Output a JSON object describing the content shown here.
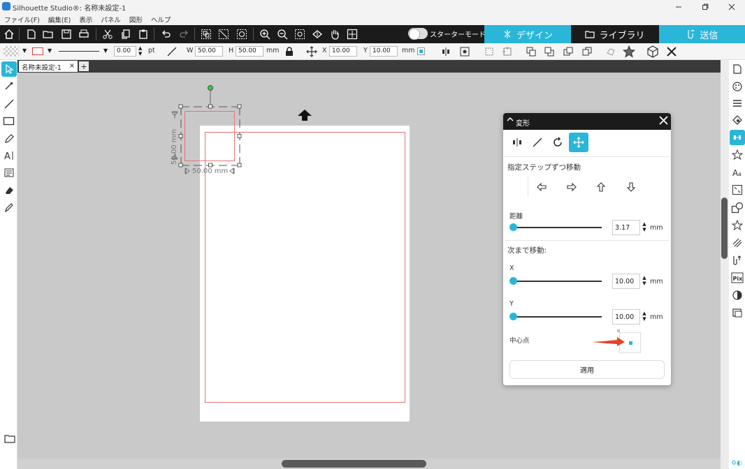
{
  "window": {
    "title": "Silhouette Studio®: 名称未設定-1"
  },
  "menu": [
    "ファイル(F)",
    "編集(E)",
    "表示",
    "パネル",
    "図形",
    "ヘルプ"
  ],
  "toolbar": {
    "starter_mode_label": "スターターモードオフ",
    "tabs": [
      {
        "label": "デザイン",
        "state": "active"
      },
      {
        "label": "ライブラリ",
        "state": "inactive"
      },
      {
        "label": "送信",
        "state": "inactive"
      }
    ]
  },
  "properties": {
    "line_width": "0.00",
    "line_unit": "pt",
    "w_label": "W",
    "w_value": "50.00",
    "h_label": "H",
    "h_value": "50.00",
    "size_unit": "mm",
    "x_label": "X",
    "x_value": "10.00",
    "y_label": "Y",
    "y_value": "10.00",
    "pos_unit": "mm"
  },
  "document": {
    "tab_label": "名称未設定-1",
    "close": "×",
    "add": "+"
  },
  "canvas": {
    "width_dim_label": "50.00 mm",
    "height_dim_label": "50.00 mm"
  },
  "transform_panel": {
    "title": "変形",
    "step_section_label": "指定ステップずつ移動",
    "distance_label": "距離",
    "distance_value": "3.17",
    "distance_unit": "mm",
    "move_to_label": "次まで移動:",
    "x_label": "X",
    "x_value": "10.00",
    "x_unit": "mm",
    "y_label": "Y",
    "y_value": "10.00",
    "y_unit": "mm",
    "center_label": "中心点",
    "apply_label": "適用"
  },
  "colors": {
    "accent": "#29b6d8",
    "toolbar_bg": "#1b1b1b",
    "annotation_arrow": "#e0442c",
    "shape_stroke": "#e57373"
  }
}
